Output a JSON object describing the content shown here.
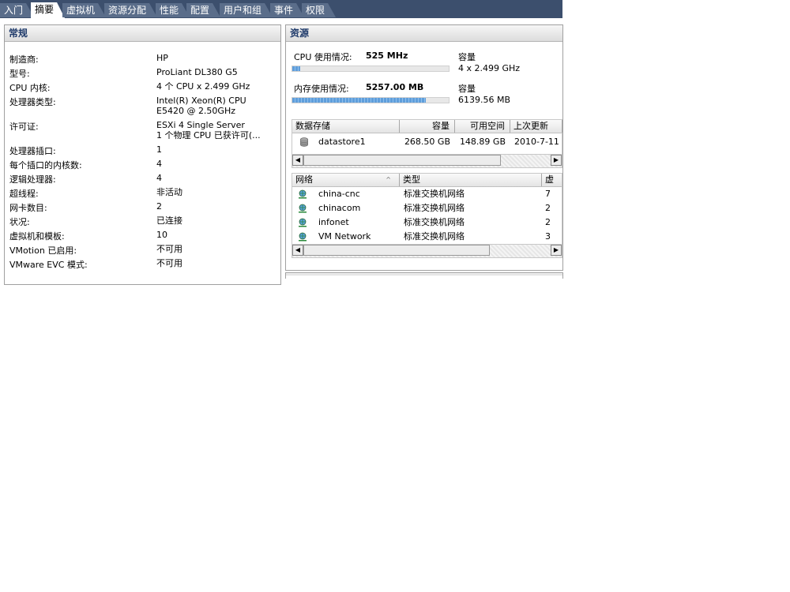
{
  "tabs": [
    {
      "label": "入门",
      "active": false
    },
    {
      "label": "摘要",
      "active": true
    },
    {
      "label": "虚拟机",
      "active": false
    },
    {
      "label": "资源分配",
      "active": false
    },
    {
      "label": "性能",
      "active": false
    },
    {
      "label": "配置",
      "active": false
    },
    {
      "label": "用户和组",
      "active": false
    },
    {
      "label": "事件",
      "active": false
    },
    {
      "label": "权限",
      "active": false
    }
  ],
  "general": {
    "title": "常规",
    "rows": [
      {
        "label": "制造商:",
        "value": "HP"
      },
      {
        "label": "型号:",
        "value": "ProLiant DL380 G5"
      },
      {
        "label": "CPU 内核:",
        "value": "4 个 CPU x 2.499 GHz"
      },
      {
        "label": "处理器类型:",
        "value": "Intel(R) Xeon(R) CPU",
        "value2": "E5420  @ 2.50GHz"
      },
      {
        "label": "许可证:",
        "value": "ESXi 4 Single Server",
        "value2": "1 个物理 CPU 已获许可(..."
      },
      {
        "label": "处理器插口:",
        "value": "1"
      },
      {
        "label": "每个插口的内核数:",
        "value": "4"
      },
      {
        "label": "逻辑处理器:",
        "value": "4"
      },
      {
        "label": "超线程:",
        "value": "非活动"
      },
      {
        "label": "网卡数目:",
        "value": "2"
      },
      {
        "label": "状况:",
        "value": "已连接"
      },
      {
        "label": "虚拟机和模板:",
        "value": "10"
      },
      {
        "label": "VMotion 已启用:",
        "value": "不可用"
      },
      {
        "label": "VMware EVC 模式:",
        "value": "不可用"
      }
    ]
  },
  "resources": {
    "title": "资源",
    "cpu": {
      "label": "CPU 使用情况:",
      "value": "525 MHz",
      "capacity_label": "容量",
      "capacity": "4 x 2.499 GHz",
      "usage_fraction": 0.052
    },
    "memory": {
      "label": "内存使用情况:",
      "value": "5257.00 MB",
      "capacity_label": "容量",
      "capacity": "6139.56 MB",
      "usage_fraction": 0.856
    },
    "datastore_table": {
      "headers": [
        "数据存储",
        "容量",
        "可用空间",
        "上次更新"
      ],
      "rows": [
        {
          "name": "datastore1",
          "capacity": "268.50 GB",
          "free": "148.89 GB",
          "updated": "2010-7-11"
        }
      ]
    },
    "network_table": {
      "headers": [
        "网络",
        "类型",
        "虚"
      ],
      "rows": [
        {
          "name": "china-cnc",
          "type": "标准交换机网络",
          "vms": "7"
        },
        {
          "name": "chinacom",
          "type": "标准交换机网络",
          "vms": "2"
        },
        {
          "name": "infonet",
          "type": "标准交换机网络",
          "vms": "2"
        },
        {
          "name": "VM Network",
          "type": "标准交换机网络",
          "vms": "3"
        }
      ]
    }
  },
  "colors": {
    "tabbar": "#3c4f6d",
    "header_text": "#1f3a6a",
    "bar_fill": "#5f9edb"
  }
}
